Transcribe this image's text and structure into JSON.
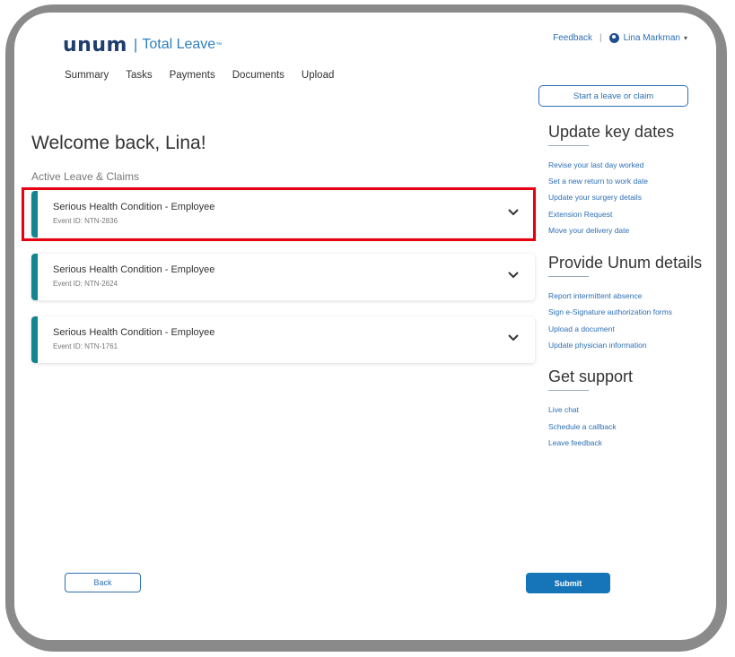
{
  "header": {
    "logo_word": "unum",
    "logo_sep": "|",
    "product_name": "Total Leave",
    "product_tm": "™",
    "feedback_label": "Feedback",
    "separator": "|",
    "user_name": "Lina Markman",
    "user_caret": "▾"
  },
  "nav": {
    "items": [
      "Summary",
      "Tasks",
      "Payments",
      "Documents",
      "Upload"
    ]
  },
  "start_button_label": "Start a leave or claim",
  "main": {
    "welcome": "Welcome back, Lina!",
    "section_label": "Active Leave & Claims",
    "claims": [
      {
        "title": "Serious Health Condition - Employee",
        "event_id": "Event ID: NTN-2836"
      },
      {
        "title": "Serious Health Condition - Employee",
        "event_id": "Event ID: NTN-2624"
      },
      {
        "title": "Serious Health Condition - Employee",
        "event_id": "Event ID: NTN-1761"
      }
    ]
  },
  "sidebar": {
    "sections": [
      {
        "heading": "Update key dates",
        "links": [
          "Revise your last day worked",
          "Set a new return to work date",
          "Update your surgery details",
          "Extension Request",
          "Move your delivery date"
        ]
      },
      {
        "heading": "Provide Unum details",
        "links": [
          "Report intermittent absence",
          "Sign e-Signature authorization forms",
          "Upload a document",
          "Update physician information"
        ]
      },
      {
        "heading": "Get support",
        "links": [
          "Live chat",
          "Schedule a callback",
          "Leave feedback"
        ]
      }
    ]
  },
  "footer": {
    "back_label": "Back",
    "submit_label": "Submit"
  },
  "colors": {
    "brand_navy": "#1f3d6e",
    "link_blue": "#2d6fb5",
    "teal_accent": "#128590",
    "submit_blue": "#1675b8",
    "highlight_red": "#e60012"
  }
}
